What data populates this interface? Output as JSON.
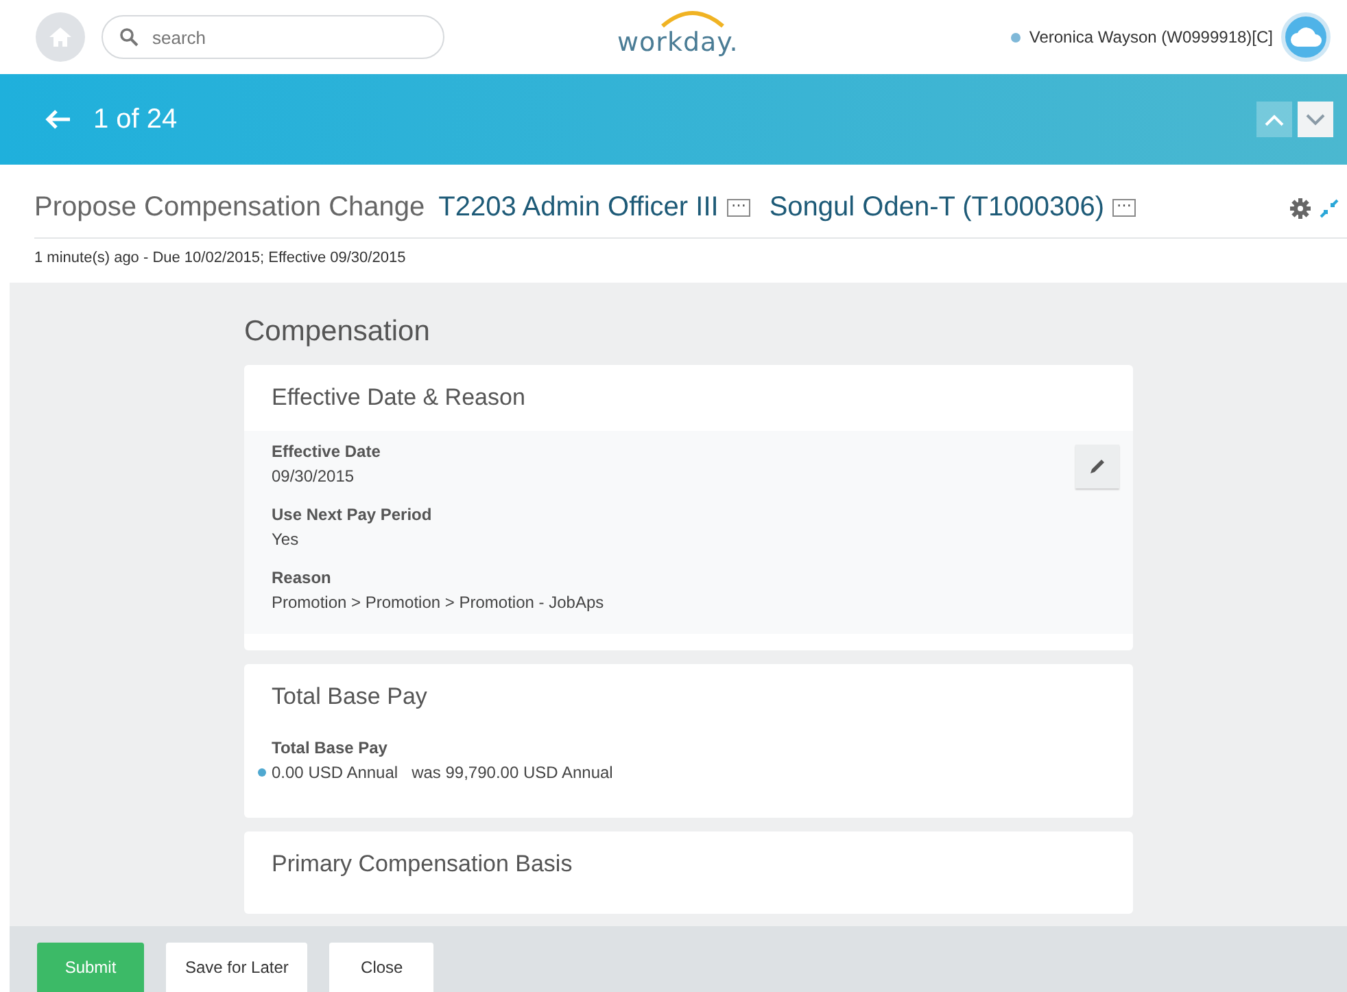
{
  "header": {
    "search": {
      "placeholder": "search"
    },
    "logo": "workday.",
    "user": {
      "name": "Veronica Wayson (W0999918)[C]",
      "color": "#7fb8d8"
    }
  },
  "nav_bar": {
    "counter": "1 of 24",
    "prev_disabled": true
  },
  "task": {
    "title": "Propose Compensation Change",
    "links": [
      {
        "label": "T2203 Admin Officer III",
        "related": "⋯"
      },
      {
        "label": "Songul Oden-T (T1000306)",
        "related": "⋯"
      }
    ],
    "subtitle": "1 minute(s) ago - Due 10/02/2015; Effective 09/30/2015"
  },
  "section_title": "Compensation",
  "cards": [
    {
      "title": "Effective Date & Reason",
      "editable": true,
      "fields": [
        {
          "label": "Effective Date",
          "value": "09/30/2015"
        },
        {
          "label": "Use Next Pay Period",
          "value": "Yes"
        },
        {
          "label": "Reason",
          "value": "Promotion > Promotion > Promotion - JobAps"
        }
      ]
    },
    {
      "title": "Total Base Pay",
      "editable": false,
      "fields": [
        {
          "label": "Total Base Pay",
          "value": "0.00 USD Annual",
          "was": "was 99,790.00 USD Annual",
          "color": "#4fa8d0"
        }
      ]
    },
    {
      "title": "Primary Compensation Basis",
      "editable": false
    }
  ],
  "buttons": [
    {
      "label": "Submit",
      "kind": "primary"
    },
    {
      "label": "Save for Later",
      "kind": "secondary"
    },
    {
      "label": "Close",
      "kind": "secondary"
    }
  ]
}
